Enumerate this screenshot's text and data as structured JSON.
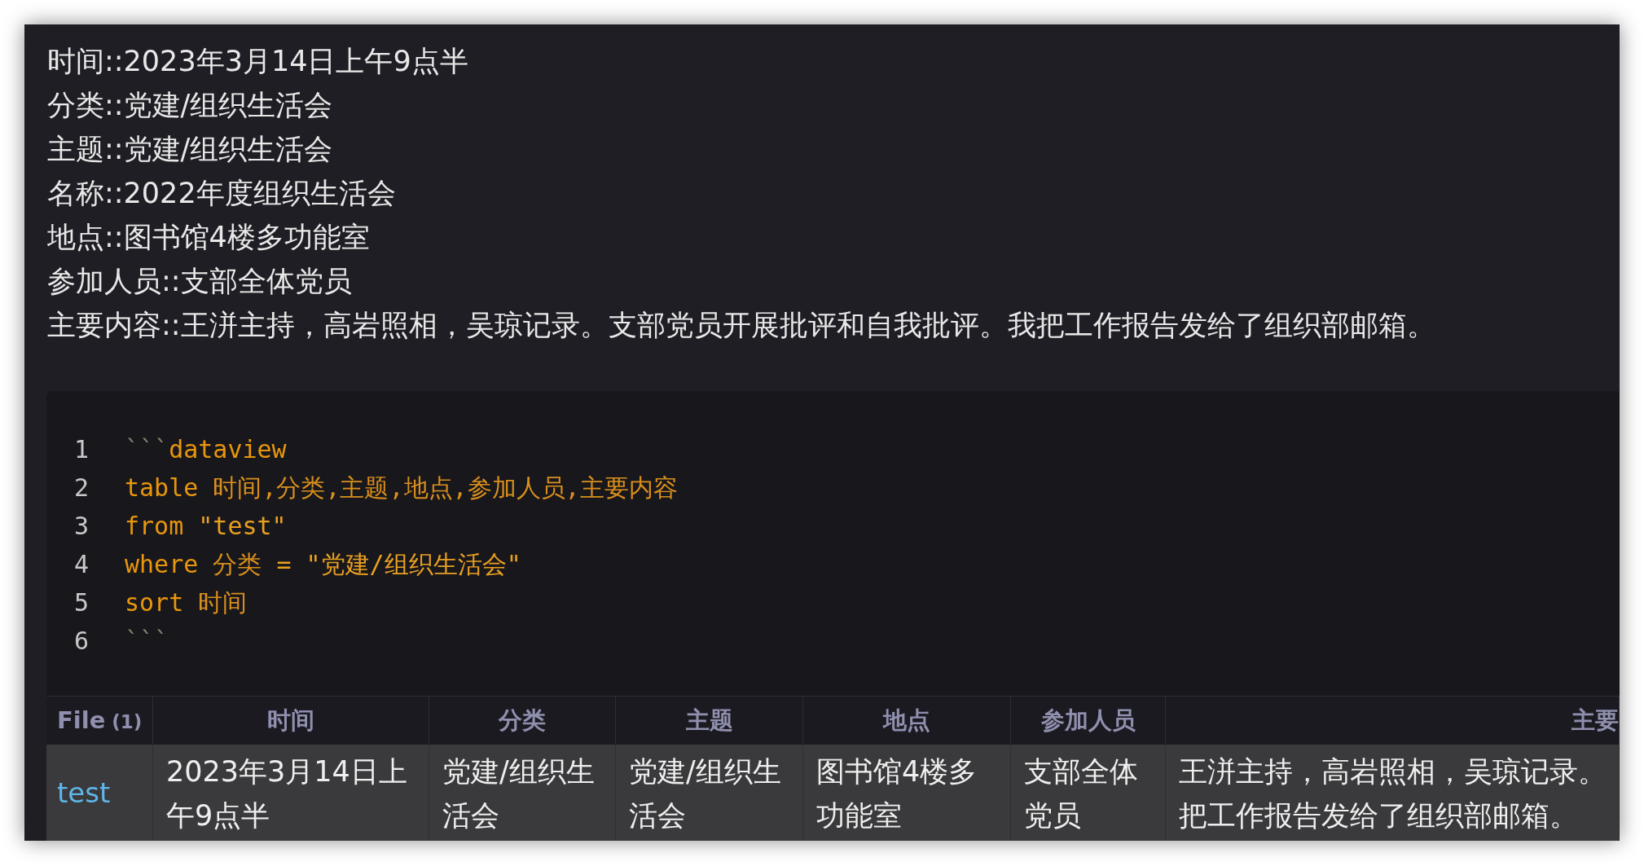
{
  "properties": [
    "时间::2023年3月14日上午9点半",
    "分类::党建/组织生活会",
    "主题::党建/组织生活会",
    "名称::2022年度组织生活会",
    "地点::图书馆4楼多功能室",
    "参加人员::支部全体党员",
    "主要内容::王洴主持，高岩照相，吴琼记录。支部党员开展批评和自我批评。我把工作报告发给了组织部邮箱。"
  ],
  "code_block": {
    "lines": [
      {
        "number": "1",
        "tokens": [
          {
            "kind": "fence",
            "text": "```"
          },
          {
            "kind": "keyword",
            "text": "dataview"
          }
        ]
      },
      {
        "number": "2",
        "tokens": [
          {
            "kind": "keyword",
            "text": "table "
          },
          {
            "kind": "field",
            "text": "时间,分类,主题,地点,参加人员,主要内容"
          }
        ]
      },
      {
        "number": "3",
        "tokens": [
          {
            "kind": "keyword",
            "text": "from "
          },
          {
            "kind": "string",
            "text": "\"test\""
          }
        ]
      },
      {
        "number": "4",
        "tokens": [
          {
            "kind": "keyword",
            "text": "where "
          },
          {
            "kind": "field",
            "text": "分类 "
          },
          {
            "kind": "string",
            "text": "= \"党建/组织生活会\""
          }
        ]
      },
      {
        "number": "5",
        "tokens": [
          {
            "kind": "keyword",
            "text": "sort "
          },
          {
            "kind": "field",
            "text": "时间"
          }
        ]
      },
      {
        "number": "6",
        "tokens": [
          {
            "kind": "fence",
            "text": "```"
          }
        ]
      }
    ]
  },
  "table": {
    "columns": [
      {
        "label": "File",
        "count": "(1)"
      },
      {
        "label": "时间"
      },
      {
        "label": "分类"
      },
      {
        "label": "主题"
      },
      {
        "label": "地点"
      },
      {
        "label": "参加人员"
      },
      {
        "label": "主要"
      }
    ],
    "rows": [
      {
        "cells": [
          [
            "test"
          ],
          [
            "2023年3月14日上",
            "午9点半"
          ],
          [
            "党建/组织生",
            "活会"
          ],
          [
            "党建/组织生",
            "活会"
          ],
          [
            "图书馆4楼多",
            "功能室"
          ],
          [
            "支部全体",
            "党员"
          ],
          [
            "王洴主持，高岩照相，吴琼记录。",
            "把工作报告发给了组织部邮箱。"
          ]
        ]
      }
    ]
  }
}
